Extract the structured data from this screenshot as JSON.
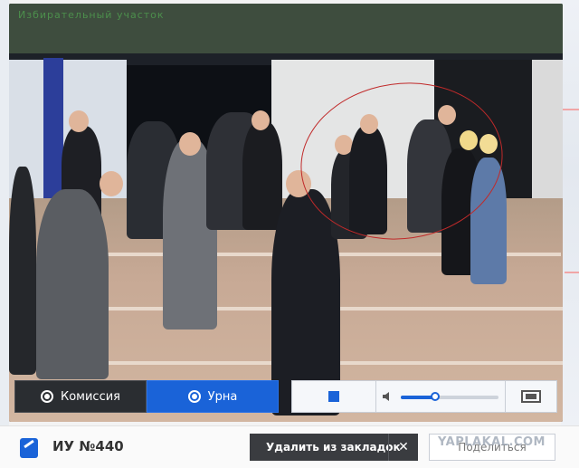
{
  "video": {
    "overlay_title": "Избирательный участок"
  },
  "controls": {
    "commission_label": "Комиссия",
    "urna_label": "Урна",
    "volume_level": 0.35
  },
  "bottom": {
    "station_label": "ИУ №440",
    "remove_bookmark_label": "Удалить из закладок",
    "close_symbol": "✕",
    "share_label": "Поделиться",
    "watermark": "YAPLAKAL.COM"
  },
  "colors": {
    "accent": "#1a63d8",
    "dark": "#2a2d31",
    "highlight": "#c02a2a"
  },
  "icons": {
    "commission": "webcam-icon",
    "urna": "webcam-icon",
    "stop": "stop-icon",
    "volume": "speaker-icon",
    "fullscreen": "fullscreen-icon",
    "station": "pen-icon",
    "close": "close-icon"
  }
}
